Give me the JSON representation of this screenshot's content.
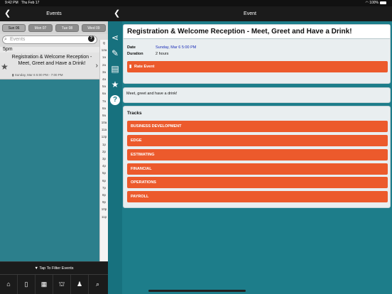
{
  "status": {
    "time": "9:42 PM",
    "date": "Thu Feb 17",
    "battery": "100%"
  },
  "left": {
    "nav_title": "Events",
    "days": [
      "Sun 06",
      "Mon 07",
      "Tue 08",
      "Wed 09"
    ],
    "search_placeholder": "Events",
    "time_header": "5pm",
    "event": {
      "title": "Registration & Welcome Reception - Meet, Greet and Have a Drink!",
      "subtitle": "Sunday, Mar 6 5:00 PM - 7:00 PM"
    },
    "index": [
      "Q",
      "12a",
      "1a",
      "2a",
      "3a",
      "4a",
      "5a",
      "6a",
      "7a",
      "8a",
      "9a",
      "10a",
      "11a",
      "12p",
      "1p",
      "2p",
      "3p",
      "4p",
      "5p",
      "6p",
      "7p",
      "8p",
      "9p",
      "10p",
      "11p"
    ],
    "filter_label": "Tap To Filter Events"
  },
  "right": {
    "nav_title": "Event",
    "event_title": "Registration & Welcome Reception - Meet, Greet and Have a Drink!",
    "date_label": "Date",
    "date_value": "Sunday, Mar 6 5:00 PM",
    "duration_label": "Duration",
    "duration_value": "2 hours",
    "rate_label": "Rate Event",
    "description": "Meet, greet and have a drink!",
    "tracks_title": "Tracks",
    "tracks": [
      "BUSINESS DEVELOPMENT",
      "EDGE",
      "ESTIMATING",
      "FINANCIAL",
      "OPERATIONS",
      "PAYROLL"
    ]
  },
  "colors": {
    "accent": "#ec5a2c",
    "teal": "#1d7d8a",
    "link": "#1a2db8"
  }
}
